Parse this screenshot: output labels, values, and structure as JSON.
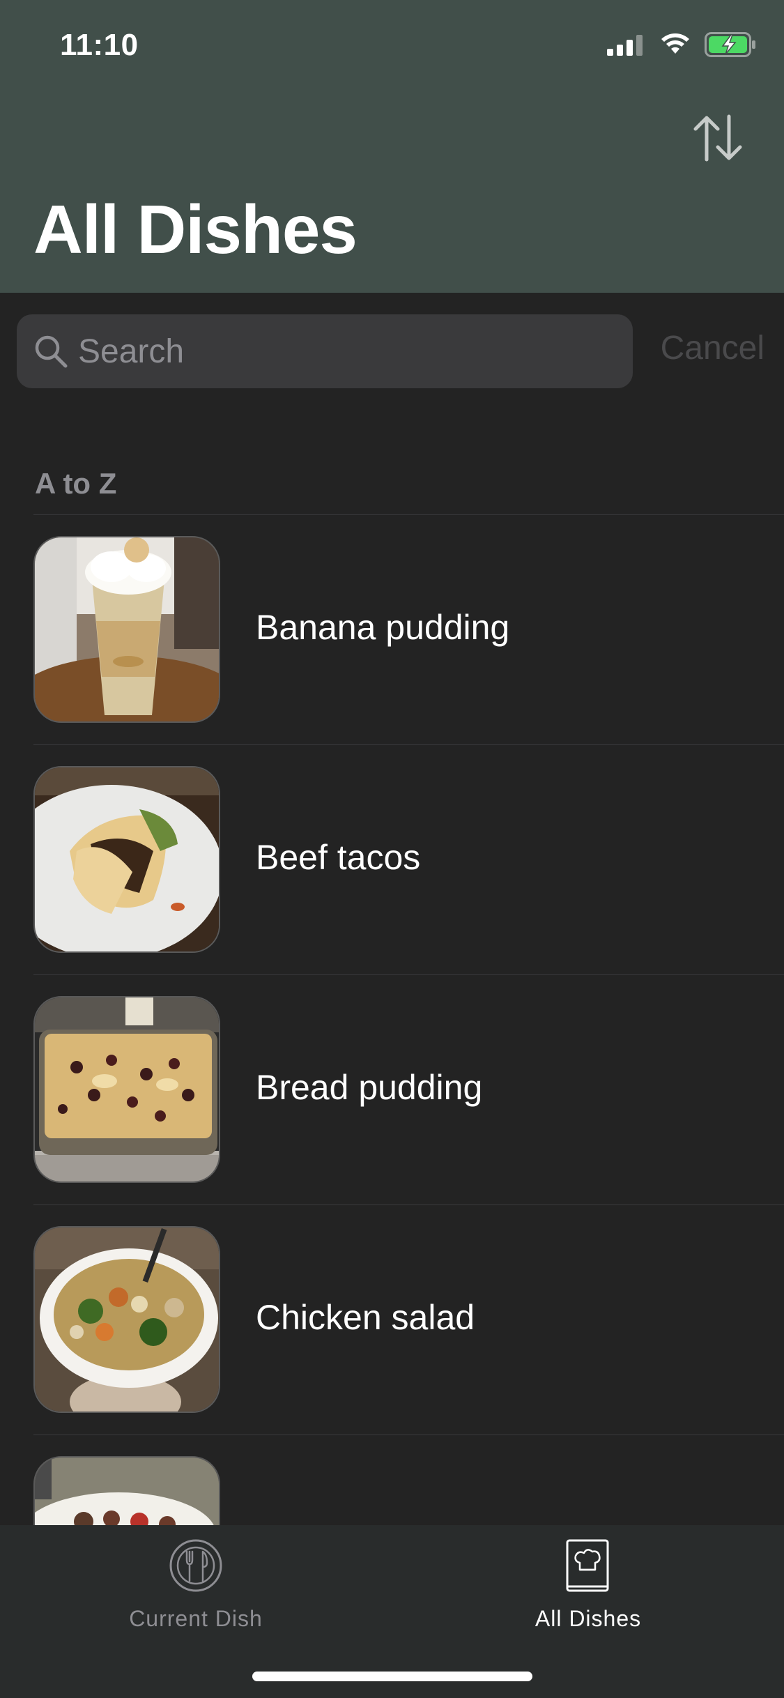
{
  "status_bar": {
    "time": "11:10",
    "signal_icon": "cellular-signal-icon",
    "wifi_icon": "wifi-icon",
    "battery_icon": "battery-charging-icon"
  },
  "header": {
    "title": "All Dishes",
    "sort_icon": "sort-arrows-icon",
    "background_color": "#414f4a"
  },
  "search": {
    "placeholder": "Search",
    "value": "",
    "cancel_label": "Cancel"
  },
  "list": {
    "section_title": "A to Z",
    "items": [
      {
        "name": "Banana pudding"
      },
      {
        "name": "Beef tacos"
      },
      {
        "name": "Bread pudding"
      },
      {
        "name": "Chicken salad"
      },
      {
        "name": ""
      }
    ]
  },
  "tab_bar": {
    "tabs": [
      {
        "label": "Current Dish",
        "icon": "plate-utensils-icon",
        "selected": false
      },
      {
        "label": "All Dishes",
        "icon": "chef-book-icon",
        "selected": true
      }
    ]
  },
  "colors": {
    "accent_header": "#414f4a",
    "list_background": "#232323",
    "tab_bar_background": "#292c2c"
  }
}
